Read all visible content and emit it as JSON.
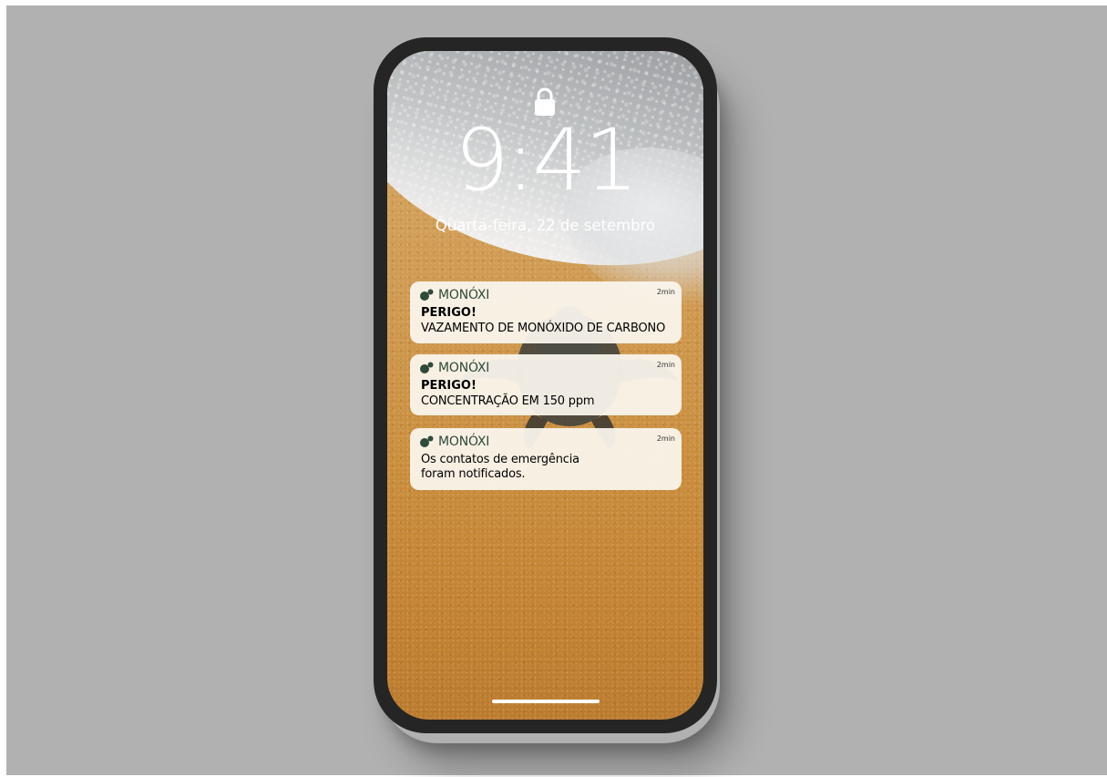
{
  "lockscreen": {
    "time": "9:41",
    "date": "Quarta-feira, 22 de setembro"
  },
  "notifications": [
    {
      "app": "MONÓXI",
      "age": "2min",
      "title": "PERIGO!",
      "body": "VAZAMENTO DE MONÓXIDO DE CARBONO"
    },
    {
      "app": "MONÓXI",
      "age": "2min",
      "title": "PERIGO!",
      "body": "CONCENTRAÇÃO EM 150 ppm"
    },
    {
      "app": "MONÓXI",
      "age": "2min",
      "body_line1": "Os contatos de emergência",
      "body_line2": "foram notificados."
    }
  ],
  "icons": {
    "lock": "lock-icon",
    "app": "monoxi-app-icon"
  },
  "colors": {
    "background": "#b1b1b1",
    "phone_frame": "#252525",
    "app_name": "#2f4a3a",
    "notification_bg": "#faf5ed"
  }
}
